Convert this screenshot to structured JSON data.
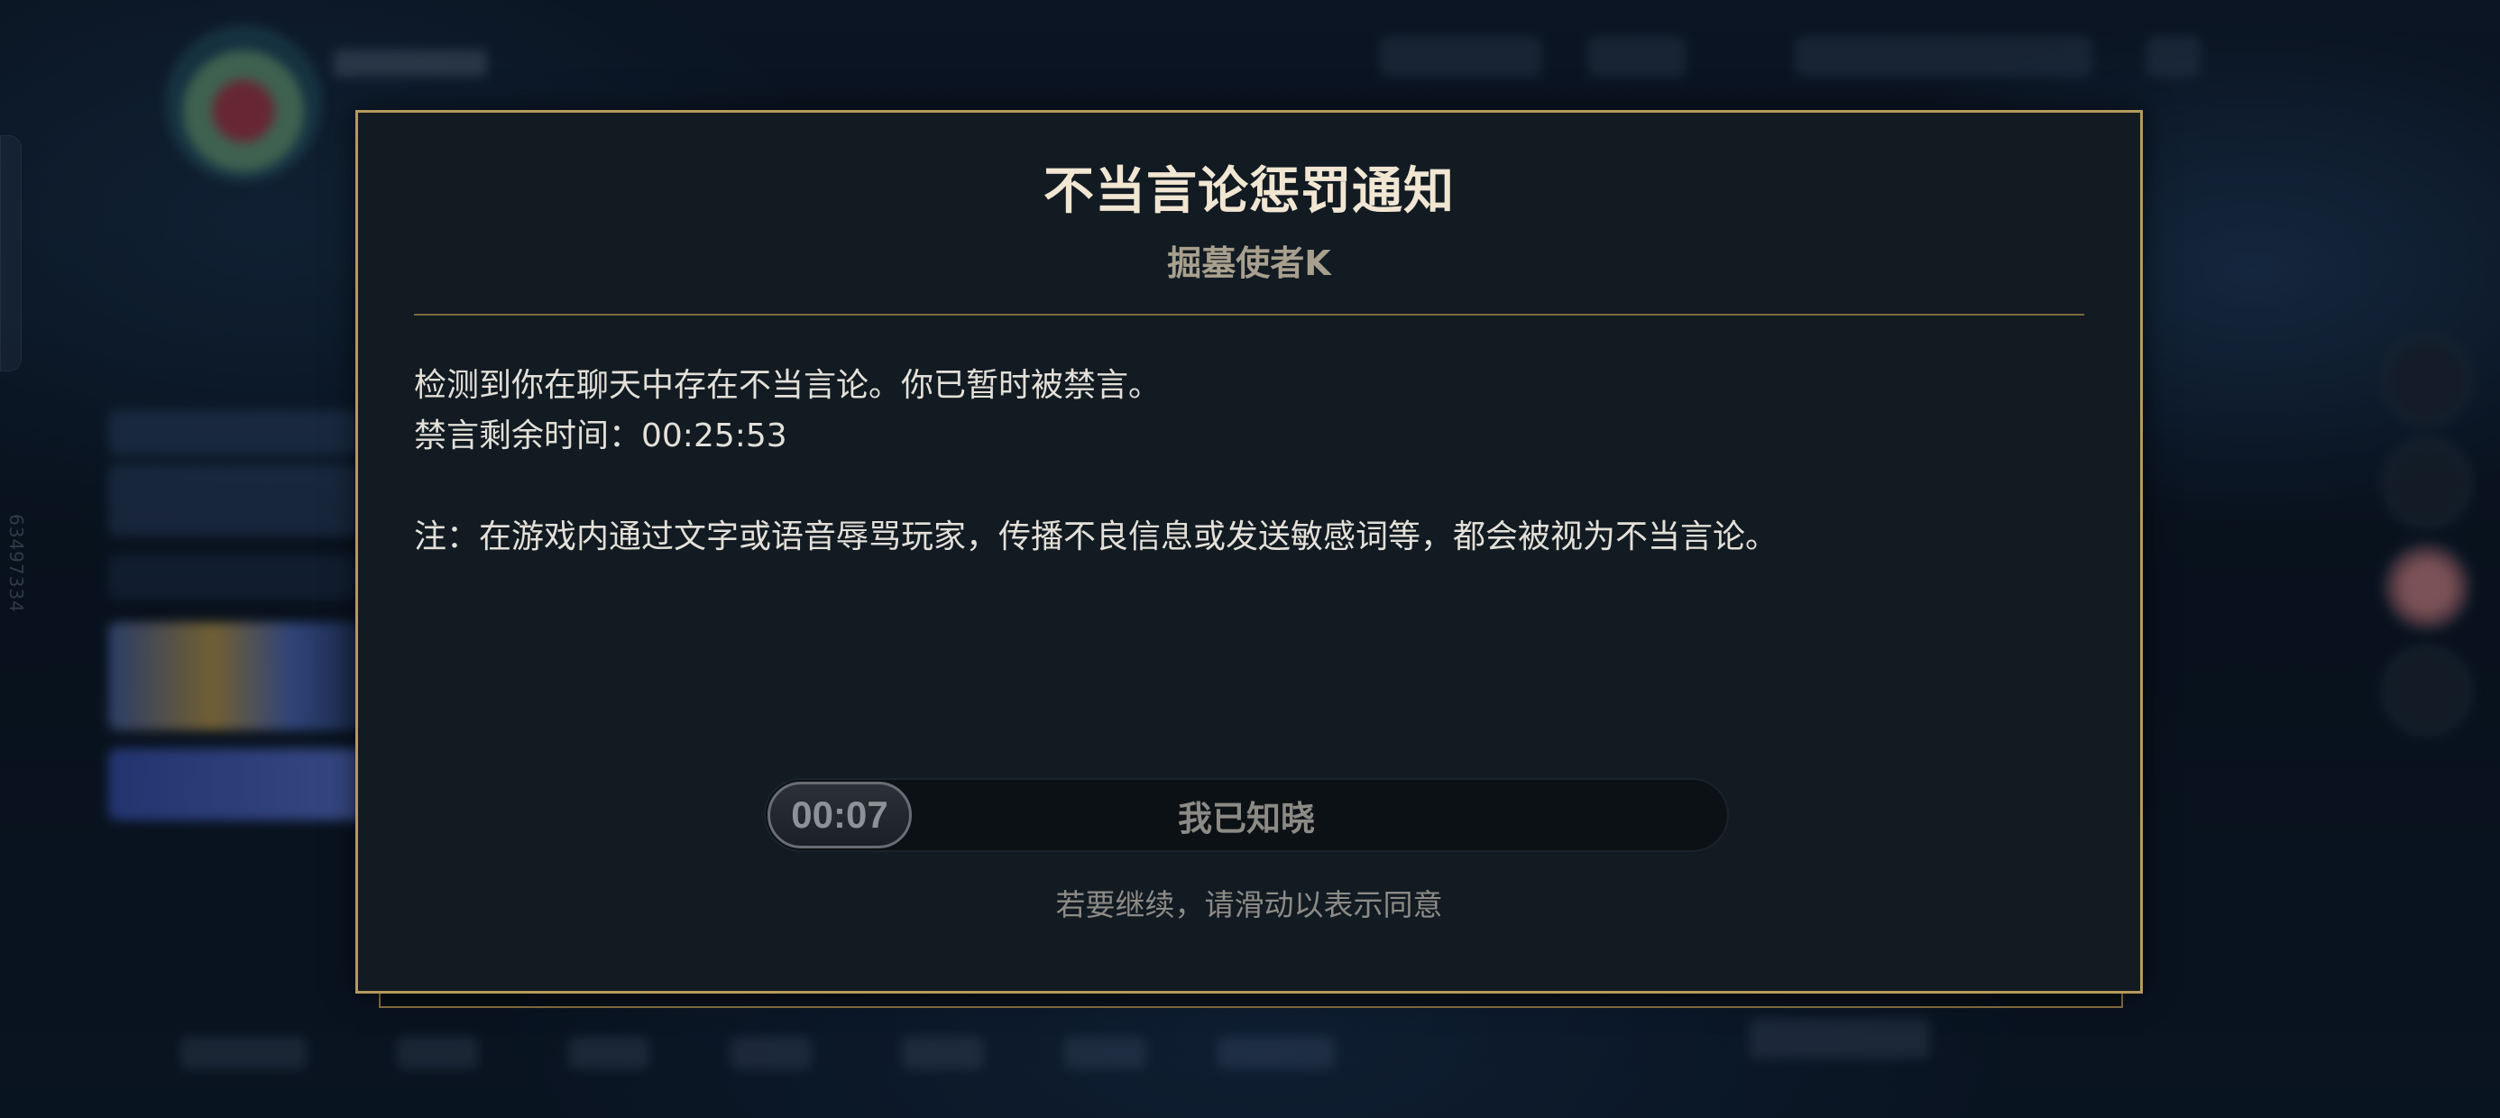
{
  "background": {
    "side_id": "63497334"
  },
  "notice": {
    "title": "不当言论惩罚通知",
    "subtitle": "掘墓使者K",
    "line1": "检测到你在聊天中存在不当言论。你已暂时被禁言。",
    "line2": "禁言剩余时间：00:25:53",
    "note": "注：在游戏内通过文字或语音辱骂玩家，传播不良信息或发送敏感词等，都会被视为不当言论。",
    "slider": {
      "timer": "00:07",
      "label": "我已知晓",
      "progress": 0
    },
    "hint": "若要继续，请滑动以表示同意"
  },
  "colors": {
    "border_gold": "#b59a5c",
    "title": "#f0e6d2",
    "panel_bg": "#121a22"
  }
}
